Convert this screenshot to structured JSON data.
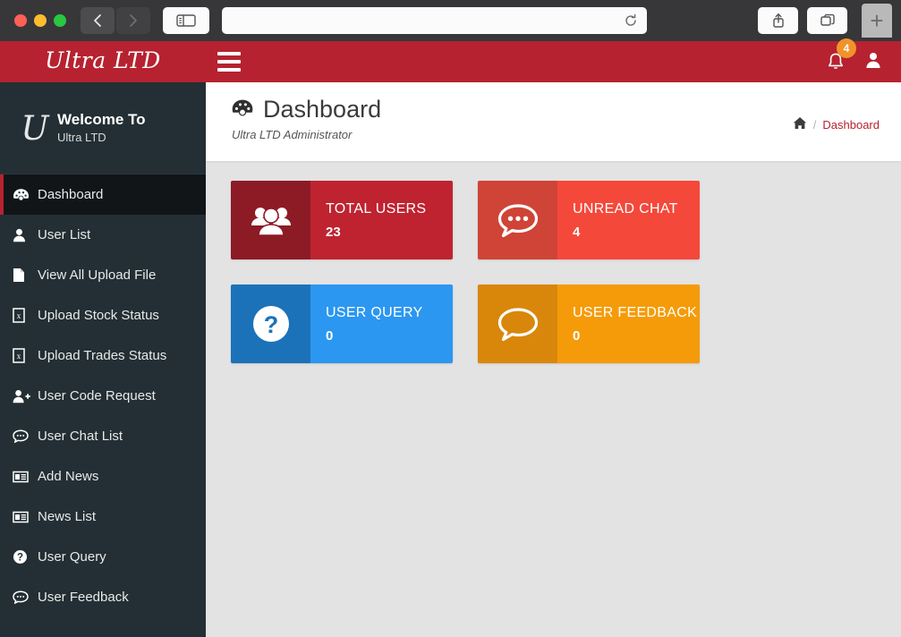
{
  "browser": {
    "url_value": "",
    "url_placeholder": "",
    "back_icon": "back-chevron-icon",
    "forward_icon": "forward-chevron-icon",
    "sidebar_icon": "sidebar-toggle-icon",
    "reload_icon": "reload-icon",
    "share_icon": "share-icon",
    "tabs_icon": "tab-overview-icon",
    "newtab_label": "+"
  },
  "navbar": {
    "brand": "Ultra LTD",
    "menu_icon": "hamburger-icon",
    "bell_icon": "bell-icon",
    "notification_count": "4",
    "user_icon": "user-avatar-icon"
  },
  "sidebar": {
    "logo_letter": "U",
    "welcome_title": "Welcome To",
    "welcome_sub": "Ultra LTD",
    "items": [
      {
        "label": "Dashboard",
        "icon": "dashboard-icon",
        "active": true
      },
      {
        "label": "User List",
        "icon": "user-icon",
        "active": false
      },
      {
        "label": "View All Upload File",
        "icon": "file-icon",
        "active": false
      },
      {
        "label": "Upload Stock Status",
        "icon": "excel-file-icon",
        "active": false
      },
      {
        "label": "Upload Trades Status",
        "icon": "excel-file-icon",
        "active": false
      },
      {
        "label": "User Code Request",
        "icon": "user-plus-icon",
        "active": false
      },
      {
        "label": "User Chat List",
        "icon": "chat-bubble-icon",
        "active": false
      },
      {
        "label": "Add News",
        "icon": "newspaper-icon",
        "active": false
      },
      {
        "label": "News List",
        "icon": "newspaper-icon",
        "active": false
      },
      {
        "label": "User Query",
        "icon": "question-circle-icon",
        "active": false
      },
      {
        "label": "User Feedback",
        "icon": "feedback-bubble-icon",
        "active": false
      }
    ]
  },
  "page": {
    "title": "Dashboard",
    "title_icon": "dashboard-icon",
    "subtitle": "Ultra LTD Administrator",
    "breadcrumb": {
      "home_icon": "home-icon",
      "separator": "/",
      "current": "Dashboard"
    }
  },
  "cards": [
    {
      "title": "TOTAL USERS",
      "value": "23",
      "color": "red",
      "icon": "users-group-icon"
    },
    {
      "title": "UNREAD CHAT",
      "value": "4",
      "color": "tomato",
      "icon": "chat-dots-icon"
    },
    {
      "title": "USER QUERY",
      "value": "0",
      "color": "blue",
      "icon": "question-circle-icon"
    },
    {
      "title": "USER FEEDBACK",
      "value": "0",
      "color": "orange",
      "icon": "speech-bubble-icon"
    }
  ],
  "colors": {
    "brand_red": "#b62230",
    "sidebar_dark": "#232f34",
    "active_dark": "#111518",
    "content_bg": "#e3e3e3",
    "badge_orange": "#f0932b"
  }
}
